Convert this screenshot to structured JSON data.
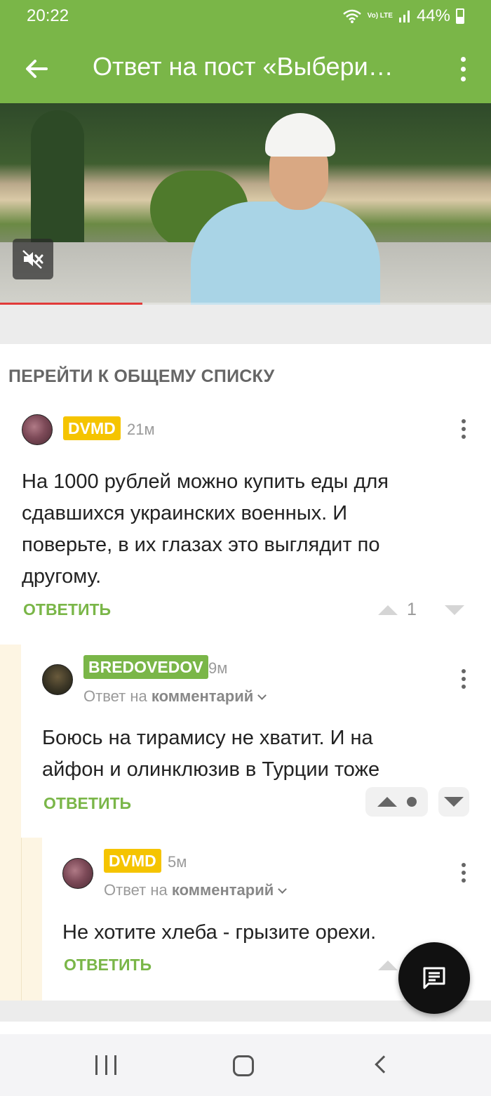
{
  "status_bar": {
    "time": "20:22",
    "network": "Vo) LTE",
    "battery": "44%",
    "battery_level": 0.44
  },
  "app_bar": {
    "title": "Ответ на пост «Выбери…",
    "back_icon": "arrow-left-icon",
    "menu_icon": "more-vertical-icon"
  },
  "video": {
    "muted": true,
    "progress": 0.29,
    "mute_icon": "volume-mute-icon"
  },
  "goto_all": "ПЕРЕЙТИ К ОБЩЕМУ СПИСКУ",
  "comments": [
    {
      "author": "DVMD",
      "time": "21м",
      "text_lines": [
        "На 1000 рублей можно купить еды для",
        "сдавшихся украинских военных. И",
        "поверьте, в их глазах это выглядит по",
        "другому."
      ],
      "reply_label": "ОТВЕТИТЬ",
      "rating": "1"
    },
    {
      "author": "BREDOVEDOV",
      "time": "9м",
      "reply_to_prefix": "Ответ на",
      "reply_to_target": "комментарий",
      "text_lines": [
        "Боюсь на тирамису не хватит. И на",
        "айфон и олинклюзив в Турции тоже"
      ],
      "reply_label": "ОТВЕТИТЬ"
    },
    {
      "author": "DVMD",
      "time": "5м",
      "reply_to_prefix": "Ответ на",
      "reply_to_target": "комментарий",
      "text_lines": [
        "Не хотите хлеба - грызите орехи."
      ],
      "reply_label": "ОТВЕТИТЬ"
    }
  ],
  "colors": {
    "brand_green": "#7ab648",
    "nick_yellow": "#f5c400",
    "thread_gutter": "#fdf5e3"
  },
  "fab_icon": "comment-icon",
  "nav": {
    "recents_icon": "recents-icon",
    "home_icon": "home-icon",
    "back_icon": "nav-back-icon"
  }
}
